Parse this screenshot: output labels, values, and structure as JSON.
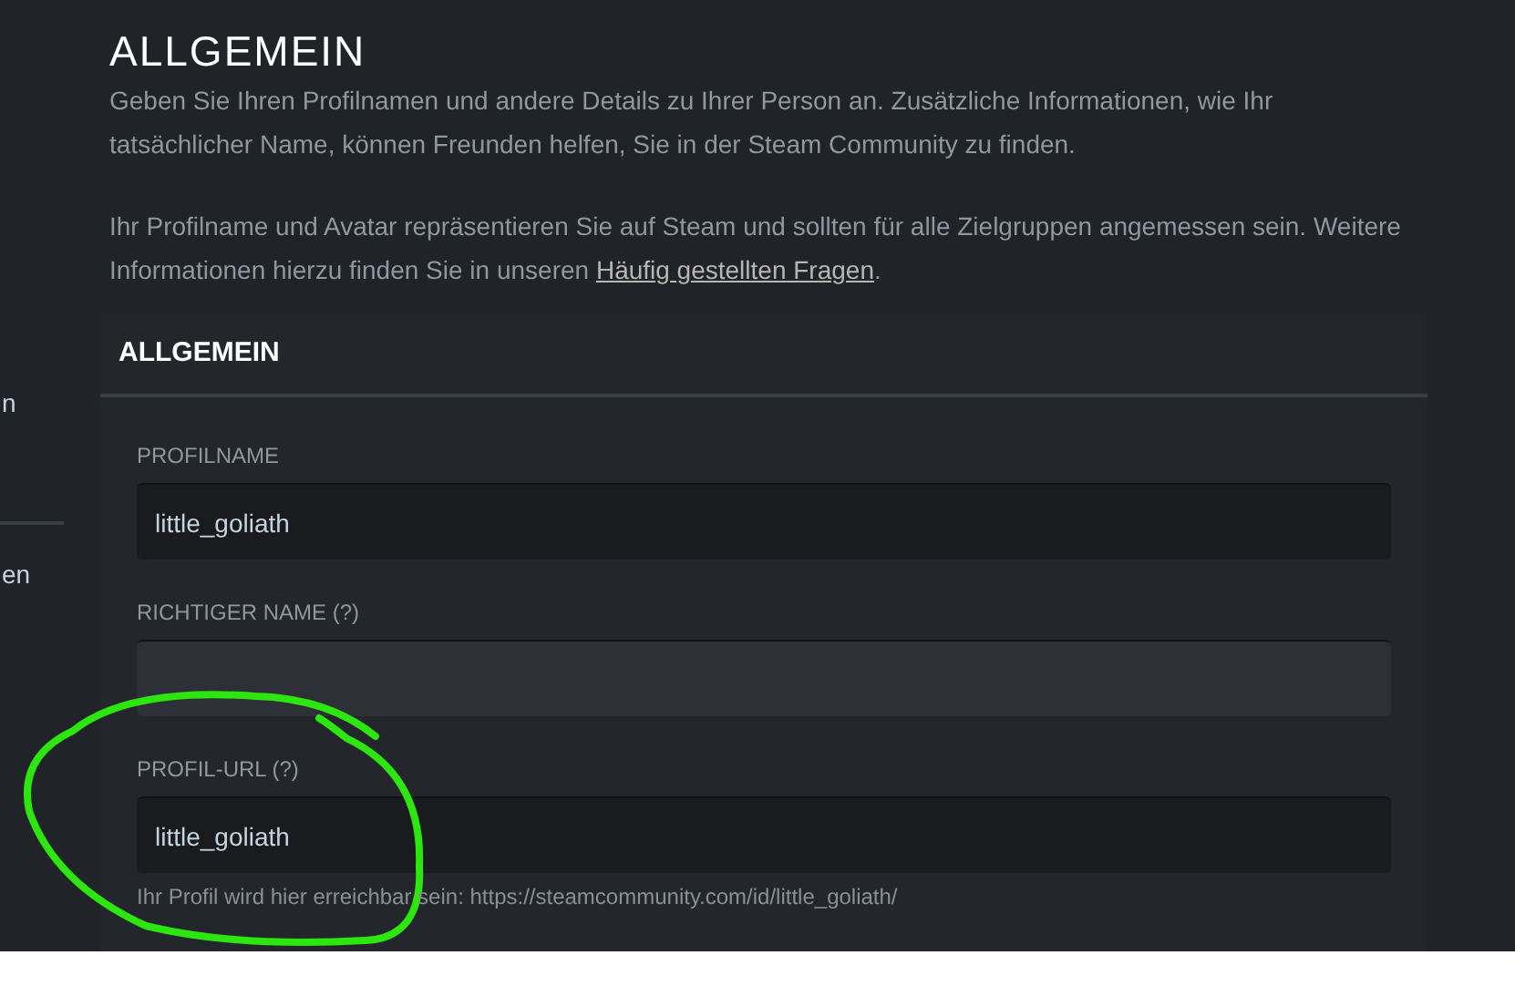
{
  "sidebar": {
    "items": [
      {
        "label": "n"
      },
      {
        "label": "en"
      }
    ]
  },
  "page_title": "ALLGEMEIN",
  "intro": [
    "Geben Sie Ihren Profilnamen und andere Details zu Ihrer Person an. Zusätzliche Informationen, wie Ihr tatsächlicher Name, können Freunden helfen, Sie in der Steam Community zu finden."
  ],
  "intro2": {
    "text": "Ihr Profilname und Avatar repräsentieren Sie auf Steam und sollten für alle Zielgruppen angemessen sein. Weitere Informationen hierzu finden Sie in unseren ",
    "link": "Häufig gestellten Fragen",
    "after": "."
  },
  "section": {
    "title": "ALLGEMEIN",
    "fields": [
      {
        "label": "PROFILNAME",
        "value": "little_goliath"
      },
      {
        "label": "RICHTIGER NAME (?)"
      },
      {
        "label": "PROFIL-URL (?)",
        "value": "little_goliath",
        "hint": "Ihr Profil wird hier erreichbar sein: https://steamcommunity.com/id/little_goliath/"
      }
    ]
  }
}
